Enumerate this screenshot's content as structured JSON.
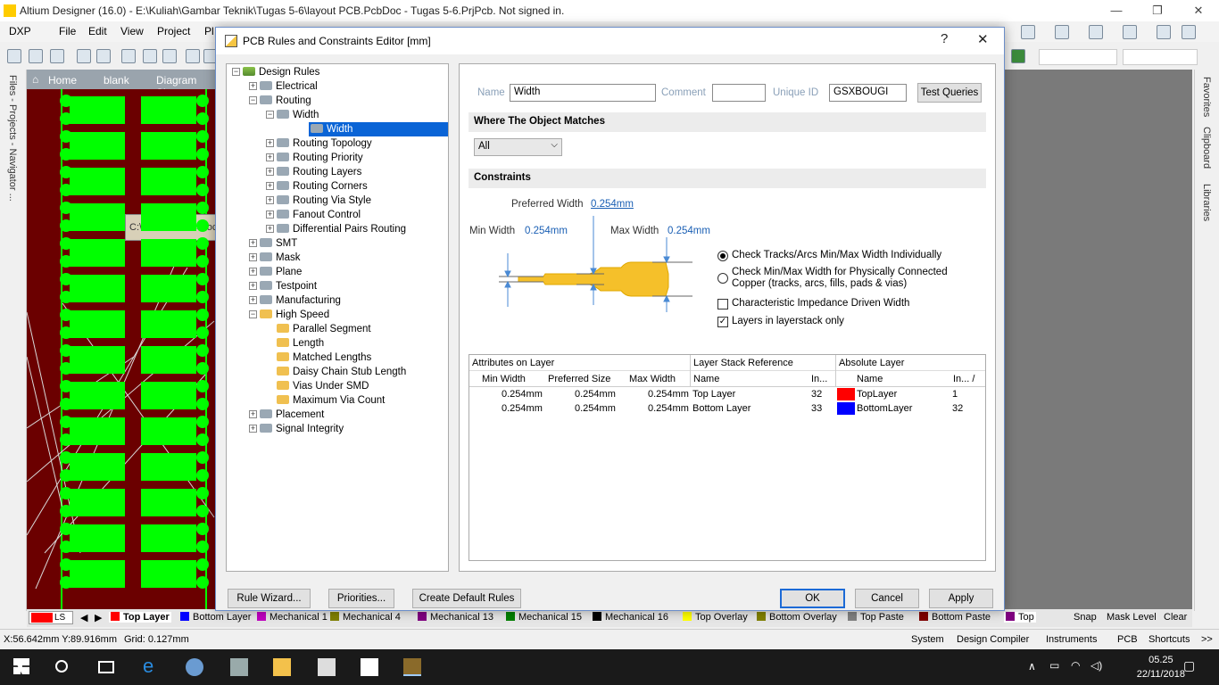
{
  "window": {
    "title": "Altium Designer (16.0) - E:\\Kuliah\\Gambar Teknik\\Tugas 5-6\\layout PCB.PcbDoc - Tugas 5-6.PrjPcb. Not signed in."
  },
  "menu": [
    "DXP",
    "File",
    "Edit",
    "View",
    "Project",
    "Pl"
  ],
  "left_panel_tabs": "Files - Projects - Navigator ...",
  "doc_tabs": [
    "Home",
    "blank",
    "Diagram Ske"
  ],
  "tooltip": "C:\\Users\\Public\\Doc",
  "right_panel_tabs": [
    "Favorites",
    "Clipboard",
    "Libraries"
  ],
  "dialog": {
    "title": "PCB Rules and Constraints Editor [mm]",
    "help": "?",
    "close": "✕",
    "tree": [
      {
        "label": "Design Rules",
        "level": 0,
        "pm": "−"
      },
      {
        "label": "Electrical",
        "level": 1,
        "pm": "+"
      },
      {
        "label": "Routing",
        "level": 1,
        "pm": "−"
      },
      {
        "label": "Width",
        "level": 2,
        "pm": "−"
      },
      {
        "label": "Width",
        "level": 3,
        "pm": "",
        "selected": true
      },
      {
        "label": "Routing Topology",
        "level": 2,
        "pm": "+"
      },
      {
        "label": "Routing Priority",
        "level": 2,
        "pm": "+"
      },
      {
        "label": "Routing Layers",
        "level": 2,
        "pm": "+"
      },
      {
        "label": "Routing Corners",
        "level": 2,
        "pm": "+"
      },
      {
        "label": "Routing Via Style",
        "level": 2,
        "pm": "+"
      },
      {
        "label": "Fanout Control",
        "level": 2,
        "pm": "+"
      },
      {
        "label": "Differential Pairs Routing",
        "level": 2,
        "pm": "+"
      },
      {
        "label": "SMT",
        "level": 1,
        "pm": "+"
      },
      {
        "label": "Mask",
        "level": 1,
        "pm": "+"
      },
      {
        "label": "Plane",
        "level": 1,
        "pm": "+"
      },
      {
        "label": "Testpoint",
        "level": 1,
        "pm": "+"
      },
      {
        "label": "Manufacturing",
        "level": 1,
        "pm": "+"
      },
      {
        "label": "High Speed",
        "level": 1,
        "pm": "−"
      },
      {
        "label": "Parallel Segment",
        "level": 2,
        "pm": ""
      },
      {
        "label": "Length",
        "level": 2,
        "pm": ""
      },
      {
        "label": "Matched Lengths",
        "level": 2,
        "pm": ""
      },
      {
        "label": "Daisy Chain Stub Length",
        "level": 2,
        "pm": ""
      },
      {
        "label": "Vias Under SMD",
        "level": 2,
        "pm": ""
      },
      {
        "label": "Maximum Via Count",
        "level": 2,
        "pm": ""
      },
      {
        "label": "Placement",
        "level": 1,
        "pm": "+"
      },
      {
        "label": "Signal Integrity",
        "level": 1,
        "pm": "+"
      }
    ],
    "name_label": "Name",
    "name_value": "Width",
    "comment_label": "Comment",
    "comment_value": "",
    "uid_label": "Unique ID",
    "uid_value": "GSXBOUGI",
    "test_queries": "Test Queries",
    "where_heading": "Where The Object Matches",
    "where_value": "All",
    "constraints_heading": "Constraints",
    "preferred_label": "Preferred Width",
    "preferred_value": "0.254mm",
    "min_label": "Min Width",
    "min_value": "0.254mm",
    "max_label": "Max Width",
    "max_value": "0.254mm",
    "radio1": "Check Tracks/Arcs Min/Max Width Individually",
    "radio2a": "Check Min/Max Width for Physically Connected",
    "radio2b": "Copper (tracks, arcs, fills, pads & vias)",
    "check1": "Characteristic Impedance Driven Width",
    "check2": "Layers in layerstack only",
    "grid": {
      "group_headers": [
        "Attributes on Layer",
        "Layer Stack Reference",
        "Absolute Layer"
      ],
      "columns": [
        "Min Width",
        "Preferred Size",
        "Max Width",
        "Name",
        "In...",
        "Name",
        "In... /"
      ],
      "rows": [
        {
          "min": "0.254mm",
          "pref": "0.254mm",
          "max": "0.254mm",
          "ref_name": "Top Layer",
          "ref_idx": "32",
          "color": "#ff0000",
          "abs_name": "TopLayer",
          "abs_idx": "1"
        },
        {
          "min": "0.254mm",
          "pref": "0.254mm",
          "max": "0.254mm",
          "ref_name": "Bottom Layer",
          "ref_idx": "33",
          "color": "#0000ff",
          "abs_name": "BottomLayer",
          "abs_idx": "32"
        }
      ]
    },
    "buttons": {
      "wizard": "Rule Wizard...",
      "priorities": "Priorities...",
      "defaults": "Create Default Rules",
      "ok": "OK",
      "cancel": "Cancel",
      "apply": "Apply"
    }
  },
  "layer_bar": {
    "ls": "LS",
    "items": [
      {
        "label": "Top Layer",
        "color": "#ff0000"
      },
      {
        "label": "Bottom Layer",
        "color": "#0000ff"
      },
      {
        "label": "Mechanical 1",
        "color": "#c000c0"
      },
      {
        "label": "Mechanical 4",
        "color": "#808000"
      },
      {
        "label": "Mechanical 13",
        "color": "#800080"
      },
      {
        "label": "Mechanical 15",
        "color": "#008000"
      },
      {
        "label": "Mechanical 16",
        "color": "#000000"
      },
      {
        "label": "Top Overlay",
        "color": "#ffff00"
      },
      {
        "label": "Bottom Overlay",
        "color": "#808000"
      },
      {
        "label": "Top Paste",
        "color": "#808080"
      },
      {
        "label": "Bottom Paste",
        "color": "#800000"
      }
    ],
    "top": "Top",
    "snap": "Snap",
    "mask": "Mask Level",
    "clear": "Clear"
  },
  "status": {
    "coords": "X:56.642mm Y:89.916mm",
    "grid": "Grid: 0.127mm",
    "panels": [
      "System",
      "Design Compiler",
      "Instruments",
      "PCB",
      "Shortcuts",
      ">>"
    ]
  },
  "taskbar": {
    "time": "05.25",
    "date": "22/11/2018"
  }
}
